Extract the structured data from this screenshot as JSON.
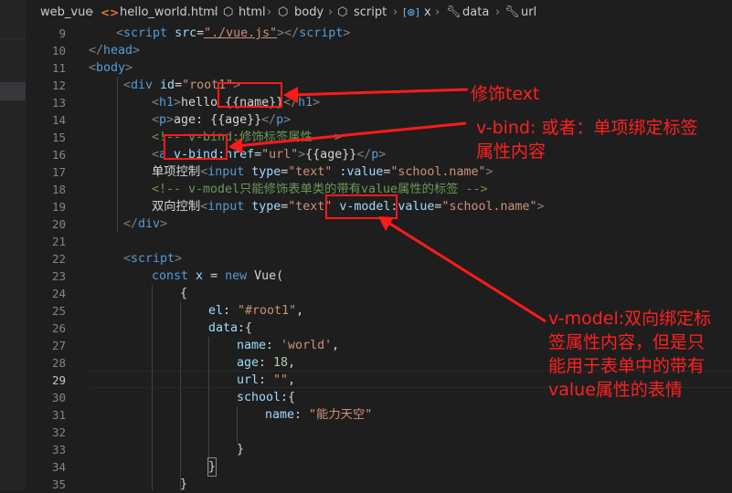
{
  "breadcrumb": {
    "items": [
      "web_vue",
      "hello_world.html",
      "html",
      "body",
      "script",
      "x",
      "data",
      "url"
    ]
  },
  "line_numbers": [
    "9",
    "10",
    "11",
    "12",
    "13",
    "14",
    "15",
    "16",
    "17",
    "18",
    "19",
    "20",
    "21",
    "22",
    "23",
    "24",
    "25",
    "26",
    "27",
    "28",
    "29",
    "30",
    "31",
    "32",
    "33",
    "34",
    "35"
  ],
  "active_line": "29",
  "code": {
    "l9": {
      "t1": "<",
      "t2": "script",
      "t3": " src",
      "t4": "=",
      "t5": "\"./vue.js\"",
      "t6": "></",
      "t7": "script",
      "t8": ">"
    },
    "l10": {
      "t1": "</",
      "t2": "head",
      "t3": ">"
    },
    "l11": {
      "t1": "<",
      "t2": "body",
      "t3": ">"
    },
    "l12": {
      "t1": "<",
      "t2": "div",
      "t3": " id",
      "t4": "=",
      "t5": "\"root1\"",
      "t6": ">"
    },
    "l13": {
      "t1": "<",
      "t2": "h1",
      "t3": ">",
      "t4": "hello ",
      "t5": "{{name}}",
      "t6": "</",
      "t7": "h1",
      "t8": ">"
    },
    "l14": {
      "t1": "<",
      "t2": "p",
      "t3": ">",
      "t4": "age: {{age}}",
      "t5": "</",
      "t6": "p",
      "t7": ">"
    },
    "l15": {
      "t1": "<!-- v-bind:修饰标签属性 -->"
    },
    "l16": {
      "t1": "<",
      "t2": "a",
      "t3": " v-bind:",
      "t4": "href",
      "t5": "=",
      "t6": "\"url\"",
      "t7": ">",
      "t8": "{{age}}",
      "t9": "</",
      "t10": "p",
      "t11": ">"
    },
    "l17": {
      "t1": "单项控制",
      "t2": "<",
      "t3": "input",
      "t4": " type",
      "t5": "=",
      "t6": "\"text\"",
      "t7": " :value",
      "t8": "=",
      "t9": "\"school.name\"",
      "t10": ">"
    },
    "l18": {
      "t1": "<!-- v-model只能修饰表单类的带有value属性的标签 -->"
    },
    "l19": {
      "t1": "双向控制",
      "t2": "<",
      "t3": "input",
      "t4": " type",
      "t5": "=",
      "t6": "\"text\"",
      "t7": " v-model:",
      "t8": "value",
      "t9": "=",
      "t10": "\"school.name\"",
      "t11": ">"
    },
    "l20": {
      "t1": "</",
      "t2": "div",
      "t3": ">"
    },
    "l22": {
      "t1": "<",
      "t2": "script",
      "t3": ">"
    },
    "l23": {
      "t1": "const",
      "t2": " x ",
      "t3": "= ",
      "t4": "new",
      "t5": " Vue("
    },
    "l24": {
      "t1": "{"
    },
    "l25": {
      "t1": "el",
      "t2": ": ",
      "t3": "\"#root1\"",
      "t4": ","
    },
    "l26": {
      "t1": "data",
      "t2": ":{"
    },
    "l27": {
      "t1": "name",
      "t2": ": ",
      "t3": "'world'",
      "t4": ","
    },
    "l28": {
      "t1": "age",
      "t2": ": ",
      "t3": "18",
      "t4": ","
    },
    "l29": {
      "t1": "url",
      "t2": ": ",
      "t3": "\"\"",
      "t4": ","
    },
    "l30": {
      "t1": "school",
      "t2": ":{"
    },
    "l31": {
      "t1": "name",
      "t2": ": ",
      "t3": "\"能力天空\""
    },
    "l33": {
      "t1": "}"
    },
    "l34": {
      "t1": "}"
    },
    "l35": {
      "t1": "}"
    }
  },
  "annotations": {
    "a1": "修饰text",
    "a2_line1": "v-bind: 或者：单项绑定标签",
    "a2_line2": "属性内容",
    "a3_line1": "v-model:双向绑定标",
    "a3_line2": "签属性内容，但是只",
    "a3_line3": "能用于表单中的带有",
    "a3_line4": "value属性的表情"
  },
  "colors": {
    "background": "#1e1e1e",
    "annotation": "#ff1a1a"
  }
}
